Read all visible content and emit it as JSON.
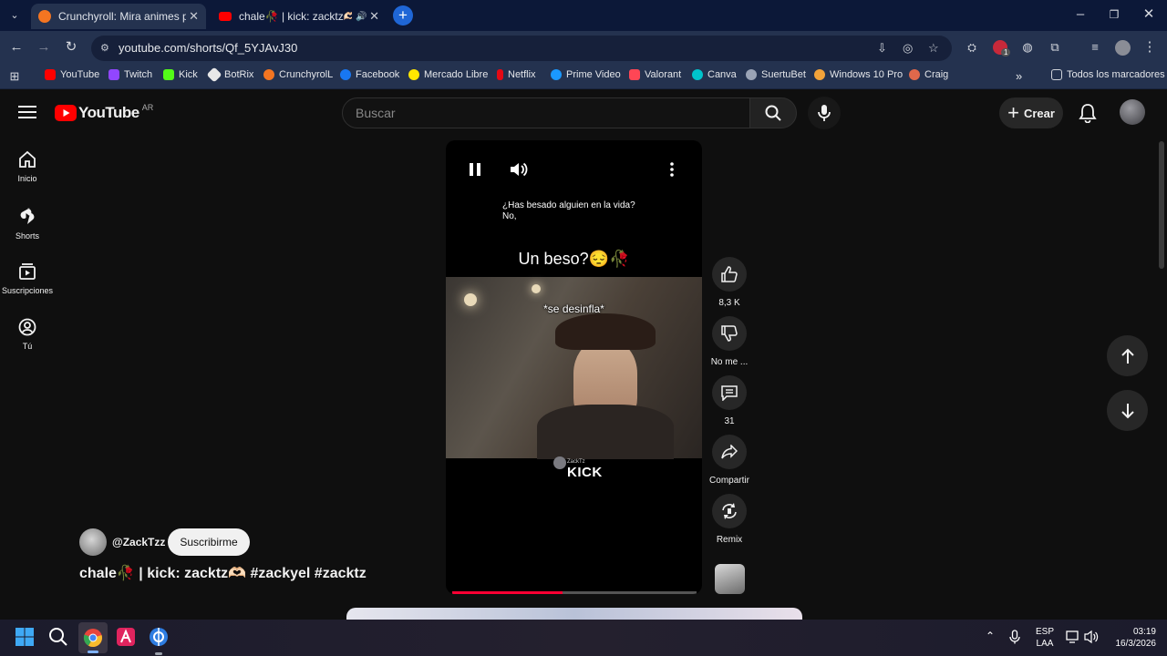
{
  "browser": {
    "tabs": [
      {
        "title": "Crunchyroll: Mira animes popul",
        "active": true
      },
      {
        "title": "chale🥀 | kick: zacktz🫶🏻 #z",
        "active": false
      }
    ],
    "url": "youtube.com/shorts/Qf_5YJAvJ30",
    "bookmarks": [
      "YouTube",
      "Twitch",
      "Kick",
      "BotRix",
      "CrunchyrolL",
      "Facebook",
      "Mercado Libre",
      "Netflix",
      "Prime Video",
      "Valorant",
      "Canva",
      "SuertuBet",
      "Windows 10 Pro",
      "Craig"
    ],
    "all_bookmarks": "Todos los marcadores",
    "profile_badge": "1"
  },
  "youtube": {
    "logo_text": "YouTube",
    "country": "AR",
    "search_placeholder": "Buscar",
    "create_label": "Crear",
    "sidebar": [
      {
        "label": "Inicio",
        "icon": "home-icon"
      },
      {
        "label": "Shorts",
        "icon": "shorts-icon"
      },
      {
        "label": "Suscripciones",
        "icon": "subscriptions-icon"
      },
      {
        "label": "Tú",
        "icon": "user-icon"
      }
    ],
    "short": {
      "caption_question": "¿Has besado alguien en la vida?",
      "caption_answer": "No,",
      "headline": "Un beso?😔🥀",
      "subtitle": "*se desinfla*",
      "watermark_user": "ZackTz",
      "watermark_brand": "KICK",
      "progress": 0.45
    },
    "actions": {
      "likes": "8,3 K",
      "dislike": "No me ...",
      "comments": "31",
      "share": "Compartir",
      "remix": "Remix"
    },
    "channel": {
      "handle": "@ZackTzz",
      "subscribe": "Suscribirme",
      "title": "chale🥀 | kick: zacktz🫶🏻 #zackyel #zacktz"
    }
  },
  "taskbar": {
    "lang": "ESP",
    "layout": "LAA",
    "time": "03:19",
    "date": "16/3/2026"
  }
}
